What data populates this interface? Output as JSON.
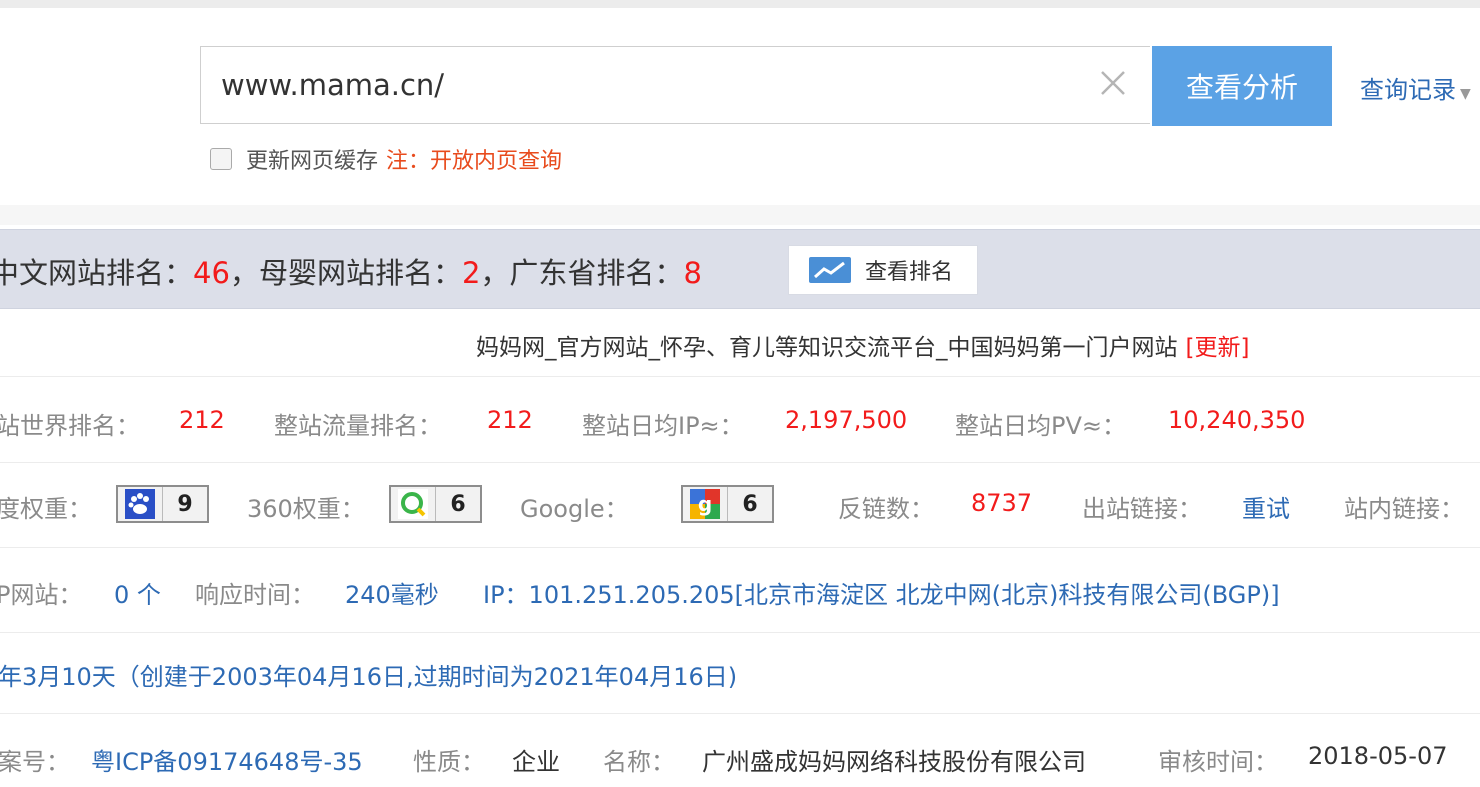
{
  "search": {
    "value": "www.mama.cn/",
    "button_label": "查看分析",
    "history_label": "查询记录",
    "cache_label": "更新网页缓存",
    "note": "注：开放内页查询"
  },
  "rank_bar": {
    "cn_label": "中文网站排名：",
    "cn_value": "46",
    "sep1": "，",
    "baby_label": "母婴网站排名：",
    "baby_value": "2",
    "sep2": "，",
    "gd_label": "广东省排名：",
    "gd_value": "8",
    "button_label": "查看排名"
  },
  "site": {
    "title": "妈妈网_官方网站_怀孕、育儿等知识交流平台_中国妈妈第一门户网站",
    "refresh_label": "[更新]"
  },
  "stats": {
    "world_rank_label": "站世界排名：",
    "world_rank_value": "212",
    "traffic_rank_label": "整站流量排名：",
    "traffic_rank_value": "212",
    "daily_ip_label": "整站日均IP≈：",
    "daily_ip_value": "2,197,500",
    "daily_pv_label": "整站日均PV≈：",
    "daily_pv_value": "10,240,350"
  },
  "weights": {
    "baidu_label": "度权重：",
    "baidu_value": "9",
    "w360_label": "360权重：",
    "w360_value": "6",
    "google_label": "Google：",
    "google_value": "6",
    "backlinks_label": "反链数：",
    "backlinks_value": "8737",
    "outbound_label": "出站链接：",
    "outbound_value": "重试",
    "internal_label": "站内链接："
  },
  "server": {
    "same_ip_label": "P网站：",
    "same_ip_value": "0 个",
    "response_label": "响应时间：",
    "response_value": "240毫秒",
    "ip_text": "IP：101.251.205.205[北京市海淀区 北龙中网(北京)科技有限公司(BGP)]"
  },
  "domain_age": {
    "text": "年3月10天（创建于2003年04月16日,过期时间为2021年04月16日)"
  },
  "icp": {
    "number_label": "案号：",
    "number_value": "粤ICP备09174648号-35",
    "nature_label": "性质：",
    "nature_value": "企业",
    "name_label": "名称：",
    "name_value": "广州盛成妈妈网络科技股份有限公司",
    "audit_label": "审核时间：",
    "audit_value": "2018-05-07"
  },
  "colors": {
    "accent_blue": "#5ba2e5",
    "link_blue": "#2d6ab4",
    "value_red": "#f21b1b",
    "note_orange": "#e84b1d",
    "rank_bar_bg": "#dcdfe9"
  }
}
